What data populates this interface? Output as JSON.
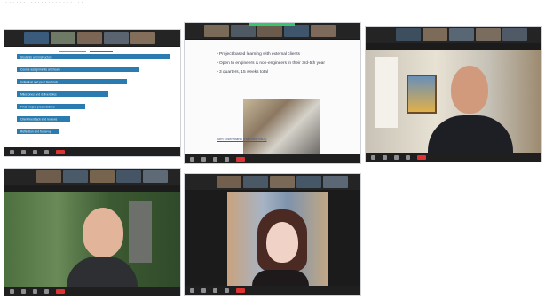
{
  "header": {
    "partial_text": "· · · · · · · · · · · · · · · · · · · · · ·"
  },
  "tile_slide": {
    "bullets": [
      "• Project based learning with external clients",
      "• Open to engineers & non-engineers in their 3rd-5th year",
      "• 3 quarters, 15 weeks total"
    ],
    "footer": "Tom Eisenmann (Harvard MBA)"
  },
  "tile_chart": {
    "bars": [
      {
        "label": "Students and instructors",
        "fill": 1.0
      },
      {
        "label": "Course assignments and team",
        "fill": 0.8
      },
      {
        "label": "Individual and peer feedback",
        "fill": 0.72
      },
      {
        "label": "Milestones and deliverables",
        "fill": 0.6
      },
      {
        "label": "Final project presentations",
        "fill": 0.45
      },
      {
        "label": "Client feedback and reviews",
        "fill": 0.35
      },
      {
        "label": "Reflection and follow-up",
        "fill": 0.28
      }
    ],
    "colors": {
      "bar": "#2a7bb0",
      "accent_green": "#39c56b",
      "accent_red": "#d43a3a"
    }
  },
  "icons": [
    "mute-icon",
    "video-icon",
    "participants-icon",
    "chat-icon",
    "share-icon",
    "record-icon",
    "reactions-icon",
    "end-call-icon"
  ]
}
